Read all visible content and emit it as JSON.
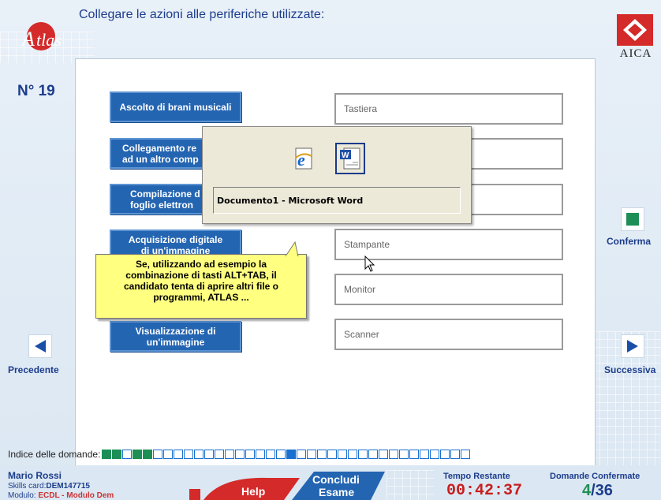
{
  "header": {
    "question_title": "Collegare le azioni alle periferiche utilizzate:",
    "question_number": "N° 19",
    "logo_left": "Atlas",
    "logo_right": "AICA"
  },
  "actions": [
    "Ascolto di brani musicali",
    "Collegamento re\nad un altro comp",
    "Compilazione d\nfoglio elettron",
    "Acquisizione digitale\ndi un'immagine",
    "Visualizzazione di\nun'immagine"
  ],
  "devices": [
    "Tastiera",
    "",
    "",
    "Stampante",
    "Monitor",
    "Scanner"
  ],
  "task_switcher": {
    "icons": [
      "internet-explorer-icon",
      "word-document-icon"
    ],
    "label": "Documento1 - Microsoft Word"
  },
  "tooltip": {
    "text": "Se, utilizzando ad esempio la combinazione di tasti ALT+TAB, il candidato tenta di aprire altri file o programmi, ATLAS ..."
  },
  "navigation": {
    "prev_label": "Precedente",
    "next_label": "Successiva",
    "confirm_label": "Conferma"
  },
  "index": {
    "label": "Indice delle domande:",
    "status": [
      "done",
      "done",
      "empty",
      "done",
      "done",
      "empty",
      "empty",
      "empty",
      "empty",
      "empty",
      "empty",
      "empty",
      "empty",
      "empty",
      "empty",
      "empty",
      "empty",
      "empty",
      "current",
      "empty",
      "empty",
      "empty",
      "empty",
      "empty",
      "empty",
      "empty",
      "empty",
      "empty",
      "empty",
      "empty",
      "empty",
      "empty",
      "empty",
      "empty",
      "empty",
      "empty"
    ]
  },
  "footer": {
    "user_name": "Mario Rossi",
    "skills_card_label": "Skills card:",
    "skills_card_value": "DEM147715",
    "module_label": "Modulo:",
    "module_value": "ECDL - Modulo Dem",
    "help_label": "Help",
    "concludi_line1": "Concludi",
    "concludi_line2": "Esame",
    "tempo_label": "Tempo Restante",
    "tempo_value": "00:42:37",
    "domande_label": "Domande Confermate",
    "domande_done": "4",
    "domande_total": "/36"
  },
  "colors": {
    "accent_blue": "#2465b2",
    "title_blue": "#1c3d8c",
    "time_red": "#c81e1e",
    "done_green": "#1d8f56",
    "tooltip_yellow": "#ffff80",
    "help_red": "#d42a2a"
  }
}
